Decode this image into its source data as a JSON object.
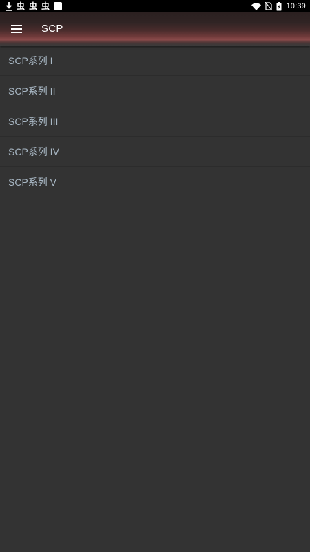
{
  "status_bar": {
    "left_icons": [
      "download-icon",
      "bug-icon",
      "bug-icon",
      "bug-icon",
      "app-square-icon"
    ],
    "right_icons": [
      "wifi-icon",
      "no-sim-icon",
      "battery-icon"
    ],
    "time": "10:39"
  },
  "app_bar": {
    "menu_icon": "hamburger-menu-icon",
    "title": "SCP"
  },
  "list": {
    "items": [
      {
        "label": "SCP系列 I"
      },
      {
        "label": "SCP系列 II"
      },
      {
        "label": "SCP系列 III"
      },
      {
        "label": "SCP系列 IV"
      },
      {
        "label": "SCP系列 V"
      }
    ]
  },
  "colors": {
    "background": "#333333",
    "status_bar": "#000000",
    "list_text": "#a9b8c5",
    "title_text": "#ffffff",
    "accent_red": "#8a4a4a"
  }
}
